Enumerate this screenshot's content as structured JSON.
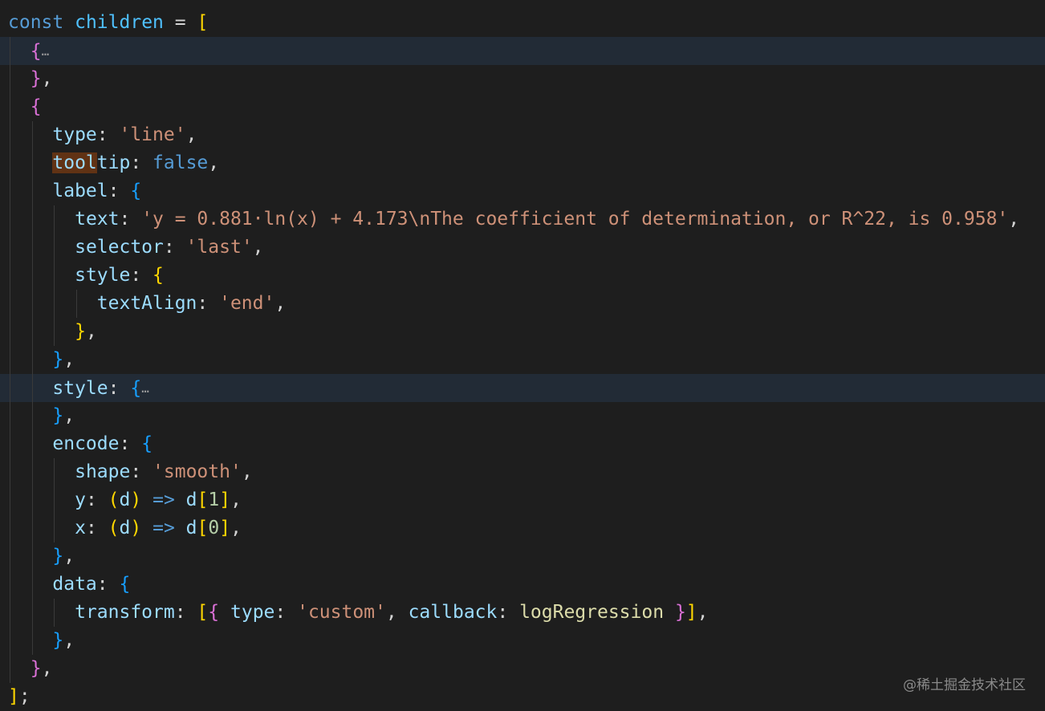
{
  "lines": [
    {
      "indent": 0,
      "tokens": [
        [
          "kw",
          "const"
        ],
        [
          "p",
          " "
        ],
        [
          "var",
          "children"
        ],
        [
          "p",
          " = "
        ],
        [
          "b1",
          "["
        ]
      ]
    },
    {
      "indent": 1,
      "highlighted": true,
      "tokens": [
        [
          "b2",
          "{"
        ],
        [
          "fold",
          "…"
        ]
      ]
    },
    {
      "indent": 1,
      "tokens": [
        [
          "b2",
          "}"
        ],
        [
          "p",
          ","
        ]
      ]
    },
    {
      "indent": 1,
      "tokens": [
        [
          "b2",
          "{"
        ]
      ]
    },
    {
      "indent": 2,
      "tokens": [
        [
          "prop",
          "type"
        ],
        [
          "p",
          ": "
        ],
        [
          "str",
          "'line'"
        ],
        [
          "p",
          ","
        ]
      ]
    },
    {
      "indent": 2,
      "tokens": [
        [
          "prop match",
          "tool"
        ],
        [
          "prop",
          "tip"
        ],
        [
          "p",
          ": "
        ],
        [
          "kw",
          "false"
        ],
        [
          "p",
          ","
        ]
      ]
    },
    {
      "indent": 2,
      "tokens": [
        [
          "prop",
          "label"
        ],
        [
          "p",
          ": "
        ],
        [
          "b3",
          "{"
        ]
      ]
    },
    {
      "indent": 3,
      "tokens": [
        [
          "prop",
          "text"
        ],
        [
          "p",
          ": "
        ],
        [
          "str",
          "'y = 0.881·ln(x) + 4.173\\nThe coefficient of determination, or R^22, is 0.958'"
        ],
        [
          "p",
          ","
        ]
      ]
    },
    {
      "indent": 3,
      "tokens": [
        [
          "prop",
          "selector"
        ],
        [
          "p",
          ": "
        ],
        [
          "str",
          "'last'"
        ],
        [
          "p",
          ","
        ]
      ]
    },
    {
      "indent": 3,
      "tokens": [
        [
          "prop",
          "style"
        ],
        [
          "p",
          ": "
        ],
        [
          "b1",
          "{"
        ]
      ]
    },
    {
      "indent": 4,
      "tokens": [
        [
          "prop",
          "textAlign"
        ],
        [
          "p",
          ": "
        ],
        [
          "str",
          "'end'"
        ],
        [
          "p",
          ","
        ]
      ]
    },
    {
      "indent": 3,
      "tokens": [
        [
          "b1",
          "}"
        ],
        [
          "p",
          ","
        ]
      ]
    },
    {
      "indent": 2,
      "tokens": [
        [
          "b3",
          "}"
        ],
        [
          "p",
          ","
        ]
      ]
    },
    {
      "indent": 2,
      "highlighted": true,
      "tokens": [
        [
          "prop",
          "style"
        ],
        [
          "p",
          ": "
        ],
        [
          "b3",
          "{"
        ],
        [
          "fold",
          "…"
        ]
      ]
    },
    {
      "indent": 2,
      "tokens": [
        [
          "b3",
          "}"
        ],
        [
          "p",
          ","
        ]
      ]
    },
    {
      "indent": 2,
      "tokens": [
        [
          "prop",
          "encode"
        ],
        [
          "p",
          ": "
        ],
        [
          "b3",
          "{"
        ]
      ]
    },
    {
      "indent": 3,
      "tokens": [
        [
          "prop",
          "shape"
        ],
        [
          "p",
          ": "
        ],
        [
          "str",
          "'smooth'"
        ],
        [
          "p",
          ","
        ]
      ]
    },
    {
      "indent": 3,
      "tokens": [
        [
          "prop",
          "y"
        ],
        [
          "p",
          ": "
        ],
        [
          "b1",
          "("
        ],
        [
          "prop",
          "d"
        ],
        [
          "b1",
          ")"
        ],
        [
          "p",
          " "
        ],
        [
          "kw",
          "=>"
        ],
        [
          "p",
          " "
        ],
        [
          "prop",
          "d"
        ],
        [
          "b1",
          "["
        ],
        [
          "num",
          "1"
        ],
        [
          "b1",
          "]"
        ],
        [
          "p",
          ","
        ]
      ]
    },
    {
      "indent": 3,
      "tokens": [
        [
          "prop",
          "x"
        ],
        [
          "p",
          ": "
        ],
        [
          "b1",
          "("
        ],
        [
          "prop",
          "d"
        ],
        [
          "b1",
          ")"
        ],
        [
          "p",
          " "
        ],
        [
          "kw",
          "=>"
        ],
        [
          "p",
          " "
        ],
        [
          "prop",
          "d"
        ],
        [
          "b1",
          "["
        ],
        [
          "num",
          "0"
        ],
        [
          "b1",
          "]"
        ],
        [
          "p",
          ","
        ]
      ]
    },
    {
      "indent": 2,
      "tokens": [
        [
          "b3",
          "}"
        ],
        [
          "p",
          ","
        ]
      ]
    },
    {
      "indent": 2,
      "tokens": [
        [
          "prop",
          "data"
        ],
        [
          "p",
          ": "
        ],
        [
          "b3",
          "{"
        ]
      ]
    },
    {
      "indent": 3,
      "tokens": [
        [
          "prop",
          "transform"
        ],
        [
          "p",
          ": "
        ],
        [
          "b1",
          "["
        ],
        [
          "b2",
          "{"
        ],
        [
          "p",
          " "
        ],
        [
          "prop",
          "type"
        ],
        [
          "p",
          ": "
        ],
        [
          "str",
          "'custom'"
        ],
        [
          "p",
          ", "
        ],
        [
          "prop",
          "callback"
        ],
        [
          "p",
          ": "
        ],
        [
          "fn",
          "logRegression"
        ],
        [
          "p",
          " "
        ],
        [
          "b2",
          "}"
        ],
        [
          "b1",
          "]"
        ],
        [
          "p",
          ","
        ]
      ]
    },
    {
      "indent": 2,
      "tokens": [
        [
          "b3",
          "}"
        ],
        [
          "p",
          ","
        ]
      ]
    },
    {
      "indent": 1,
      "tokens": [
        [
          "b2",
          "}"
        ],
        [
          "p",
          ","
        ]
      ]
    },
    {
      "indent": 0,
      "tokens": [
        [
          "b1",
          "]"
        ],
        [
          "p",
          ";"
        ]
      ]
    }
  ],
  "watermark": "@稀土掘金技术社区"
}
